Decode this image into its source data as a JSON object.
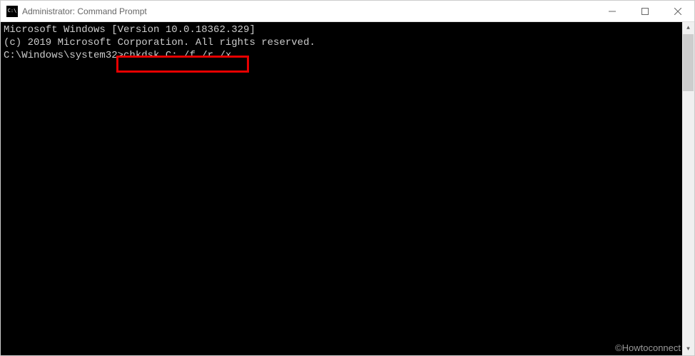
{
  "window": {
    "title": "Administrator: Command Prompt"
  },
  "terminal": {
    "line1": "Microsoft Windows [Version 10.0.18362.329]",
    "line2": "(c) 2019 Microsoft Corporation. All rights reserved.",
    "blank": "",
    "prompt": "C:\\Windows\\system32>",
    "command": "chkdsk C: /f /r /x"
  },
  "watermark": "©Howtoconnect"
}
